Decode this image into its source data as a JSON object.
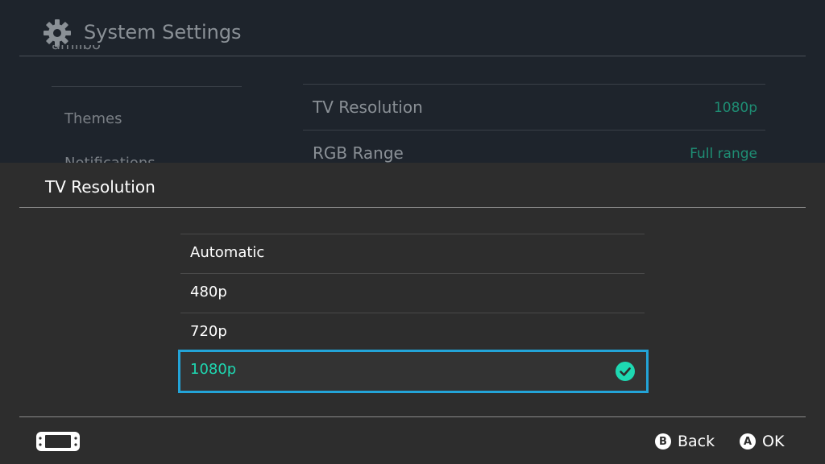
{
  "background": {
    "title": "System Settings",
    "left_items": [
      "amiibo",
      "Themes",
      "Notifications"
    ],
    "rows": [
      {
        "label": "TV Resolution",
        "value": "1080p"
      },
      {
        "label": "RGB Range",
        "value": "Full range"
      }
    ]
  },
  "modal": {
    "title": "TV Resolution",
    "options": [
      "Automatic",
      "480p",
      "720p",
      "1080p"
    ],
    "selected": "1080p"
  },
  "footer": {
    "back_key": "B",
    "back_label": "Back",
    "ok_key": "A",
    "ok_label": "OK"
  },
  "colors": {
    "accent": "#1ed8b2",
    "focus_border": "#23a4d8"
  }
}
